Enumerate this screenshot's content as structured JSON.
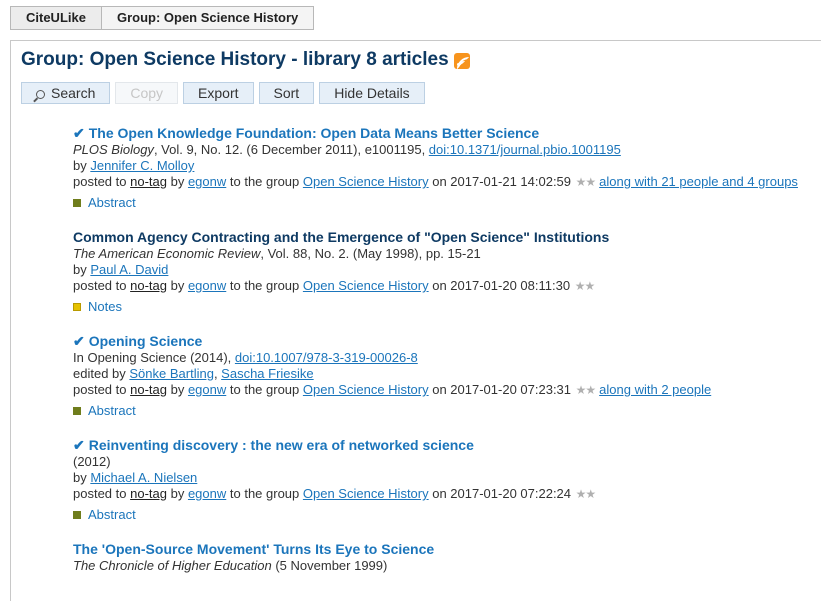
{
  "tabs": [
    {
      "label": "CiteULike"
    },
    {
      "label": "Group: Open Science History"
    }
  ],
  "page_title": "Group: Open Science History - library 8 articles",
  "toolbar": {
    "search": "Search",
    "copy": "Copy",
    "export": "Export",
    "sort": "Sort",
    "hide_details": "Hide Details"
  },
  "articles": [
    {
      "check": "✔",
      "title": "The Open Knowledge Foundation: Open Data Means Better Science",
      "journal": "PLOS Biology",
      "details": ", Vol. 9, No. 12. (6 December 2011), e1001195, ",
      "doi": "doi:10.1371/journal.pbio.1001195",
      "by_prefix": "by ",
      "authors": [
        "Jennifer C. Molloy"
      ],
      "posted_to": "posted to ",
      "tag": "no-tag",
      "by": " by ",
      "user": "egonw",
      "to_group": " to the group ",
      "group": "Open Science History",
      "on": " on 2017-01-21 14:02:59",
      "stars": "★★",
      "along": "along with 21 people and 4 groups",
      "extra": "Abstract"
    },
    {
      "title": "Common Agency Contracting and the Emergence of \"Open Science\" Institutions",
      "journal": "The American Economic Review",
      "details": ", Vol. 88, No. 2. (May 1998), pp. 15-21",
      "by_prefix": "by ",
      "authors": [
        "Paul A. David"
      ],
      "posted_to": "posted to ",
      "tag": "no-tag",
      "by": " by ",
      "user": "egonw",
      "to_group": " to the group ",
      "group": "Open Science History",
      "on": " on 2017-01-20 08:11:30",
      "stars": "★★",
      "extra": "Notes"
    },
    {
      "check": "✔",
      "title": "Opening Science",
      "source": "In Opening Science (2014), ",
      "doi": "doi:10.1007/978-3-319-00026-8",
      "by_prefix": "edited by ",
      "authors": [
        "Sönke Bartling",
        "Sascha Friesike"
      ],
      "author_sep": ", ",
      "posted_to": "posted to ",
      "tag": "no-tag",
      "by": " by ",
      "user": "egonw",
      "to_group": " to the group ",
      "group": "Open Science History",
      "on": " on 2017-01-20 07:23:31",
      "stars": "★★",
      "along": "along with 2 people",
      "extra": "Abstract"
    },
    {
      "check": "✔",
      "title": "Reinventing discovery : the new era of networked science",
      "source": "(2012)",
      "by_prefix": "by ",
      "authors": [
        "Michael A. Nielsen"
      ],
      "posted_to": "posted to ",
      "tag": "no-tag",
      "by": " by ",
      "user": "egonw",
      "to_group": " to the group ",
      "group": "Open Science History",
      "on": " on 2017-01-20 07:22:24",
      "stars": "★★",
      "extra": "Abstract"
    },
    {
      "title": "The 'Open-Source Movement' Turns Its Eye to Science",
      "journal": "The Chronicle of Higher Education",
      "details": " (5 November 1999)"
    }
  ],
  "colors": {
    "title_link": "#1b75bb",
    "title_dark": "#0e3a63",
    "abstract_marker": "#6f7d1c",
    "notes_marker": "#e6c200",
    "rss": "#f7941d"
  }
}
